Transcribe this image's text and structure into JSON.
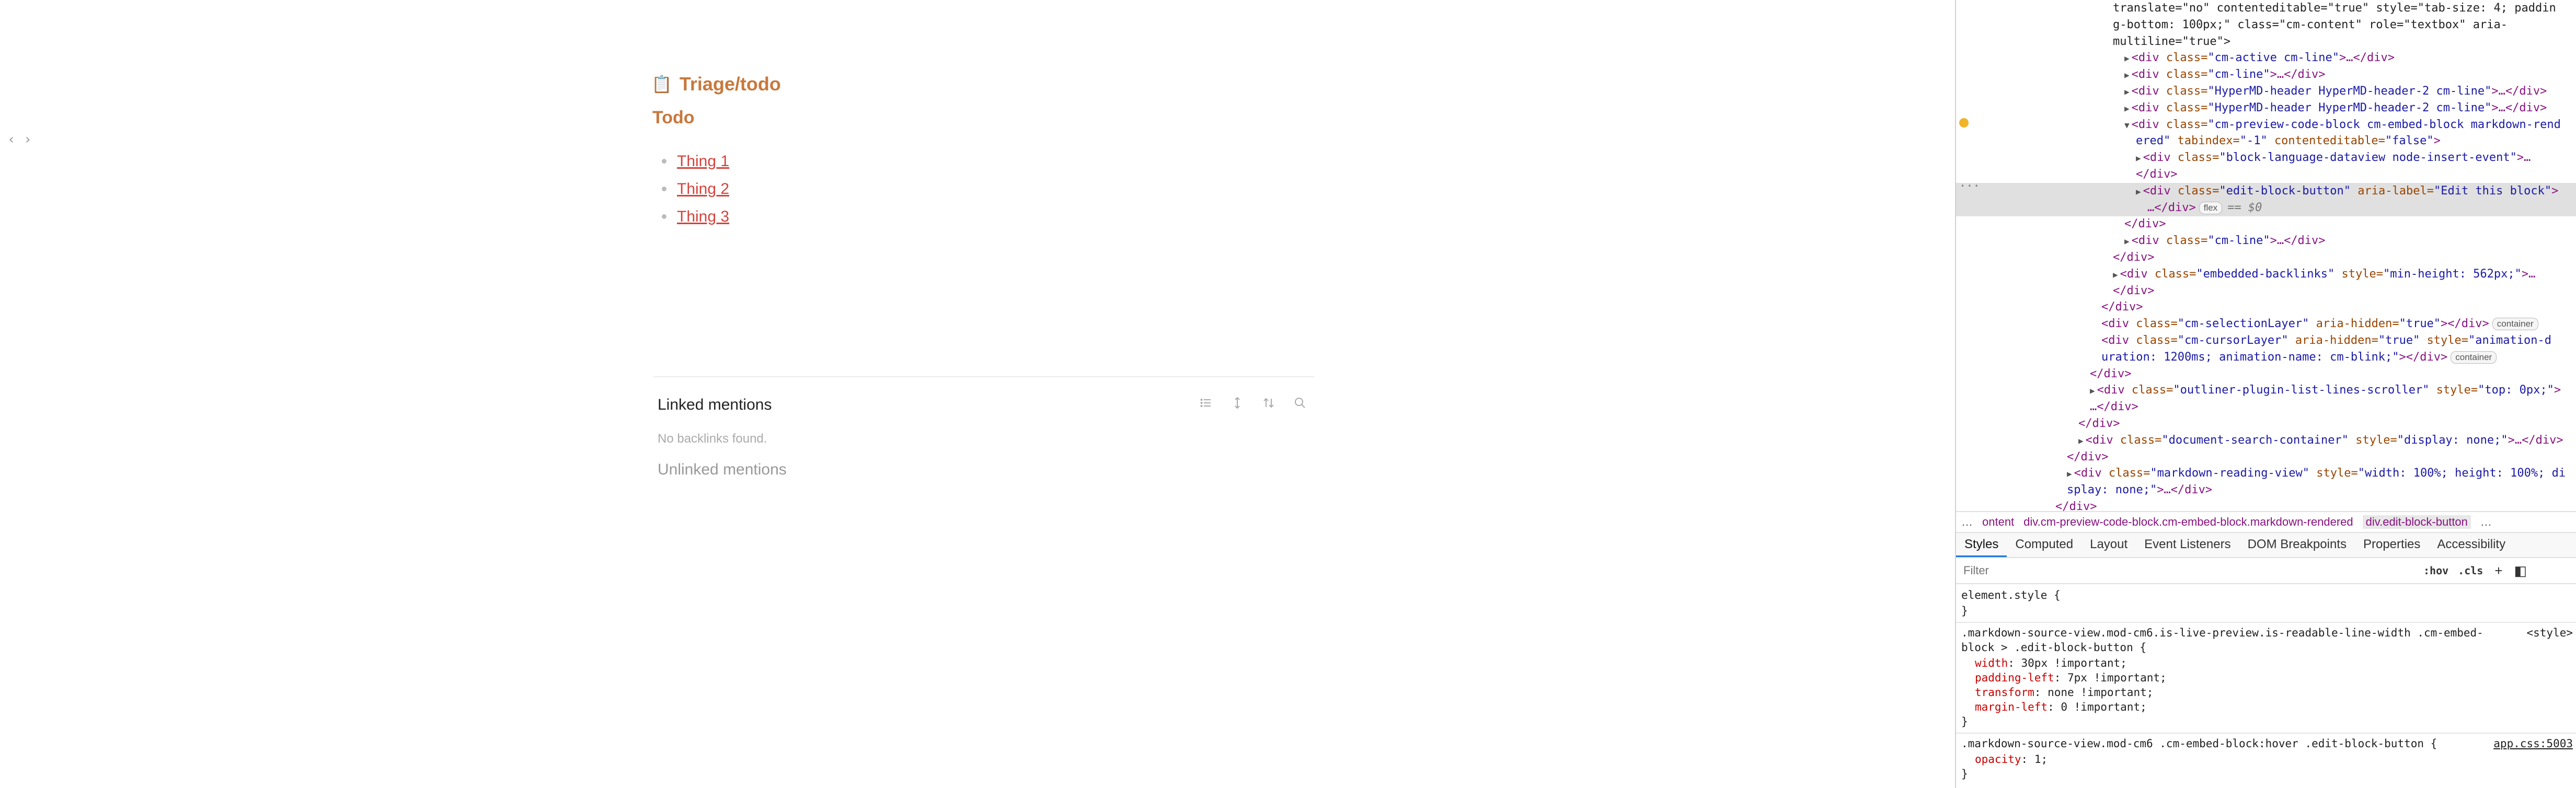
{
  "note": {
    "toggle": "‹ ›",
    "title_emoji": "📋",
    "title": "Triage/todo",
    "heading": "Todo",
    "items": [
      "Thing 1",
      "Thing 2",
      "Thing 3"
    ],
    "linked_mentions": "Linked mentions",
    "no_backlinks": "No backlinks found.",
    "unlinked_mentions": "Unlinked mentions"
  },
  "devtools": {
    "dom_lines": [
      {
        "parts": [
          [
            "tx",
            "translate=\"no\" contenteditable=\"true\" style=\"tab-size: 4; paddin"
          ]
        ]
      },
      {
        "parts": [
          [
            "tx",
            "g-bottom: 100px;\" class=\"cm-content\" role=\"textbox\" aria-"
          ]
        ]
      },
      {
        "parts": [
          [
            "tx",
            "multiline=\"true\">"
          ]
        ]
      },
      {
        "parts": [
          [
            "tri",
            "▶"
          ],
          [
            "tg",
            "<div "
          ],
          [
            "an",
            "class="
          ],
          [
            "av",
            "\"cm-active cm-line\""
          ],
          [
            "tg",
            ">…</div>"
          ]
        ]
      },
      {
        "parts": [
          [
            "tri",
            "▶"
          ],
          [
            "tg",
            "<div "
          ],
          [
            "an",
            "class="
          ],
          [
            "av",
            "\"cm-line\""
          ],
          [
            "tg",
            ">…</div>"
          ]
        ]
      },
      {
        "parts": [
          [
            "tri",
            "▶"
          ],
          [
            "tg",
            "<div "
          ],
          [
            "an",
            "class="
          ],
          [
            "av",
            "\"HyperMD-header HyperMD-header-2 cm-line\""
          ],
          [
            "tg",
            ">…</div>"
          ]
        ]
      },
      {
        "parts": [
          [
            "tri",
            "▶"
          ],
          [
            "tg",
            "<div "
          ],
          [
            "an",
            "class="
          ],
          [
            "av",
            "\"HyperMD-header HyperMD-header-2 cm-line\""
          ],
          [
            "tg",
            ">…</div>"
          ]
        ]
      },
      {
        "parts": [
          [
            "tri",
            "▼"
          ],
          [
            "tg",
            "<div "
          ],
          [
            "an",
            "class="
          ],
          [
            "av",
            "\"cm-preview-code-block cm-embed-block markdown-rend"
          ]
        ]
      },
      {
        "parts": [
          [
            "av",
            "ered\" "
          ],
          [
            "an",
            "tabindex="
          ],
          [
            "av",
            "\"-1\" "
          ],
          [
            "an",
            "contenteditable="
          ],
          [
            "av",
            "\"false\""
          ],
          [
            "tg",
            ">"
          ]
        ]
      },
      {
        "parts": [
          [
            "tri",
            "▶"
          ],
          [
            "tg",
            "<div "
          ],
          [
            "an",
            "class="
          ],
          [
            "av",
            "\"block-language-dataview node-insert-event\""
          ],
          [
            "tg",
            ">…"
          ]
        ]
      },
      {
        "parts": [
          [
            "tg",
            "</div>"
          ]
        ]
      },
      {
        "parts": [
          [
            "tri",
            "▶"
          ],
          [
            "tg",
            "<div "
          ],
          [
            "an",
            "class="
          ],
          [
            "av",
            "\"edit-block-button\" "
          ],
          [
            "an",
            "aria-label="
          ],
          [
            "av",
            "\"Edit this block\""
          ],
          [
            "tg",
            ">"
          ]
        ]
      },
      {
        "parts": [
          [
            "tg",
            "…</div>"
          ],
          [
            "pill",
            "flex"
          ],
          [
            "eq",
            "== $0"
          ]
        ]
      },
      {
        "parts": [
          [
            "tg",
            "</div>"
          ]
        ]
      },
      {
        "parts": [
          [
            "tri",
            "▶"
          ],
          [
            "tg",
            "<div "
          ],
          [
            "an",
            "class="
          ],
          [
            "av",
            "\"cm-line\""
          ],
          [
            "tg",
            ">…</div>"
          ]
        ]
      },
      {
        "parts": [
          [
            "tg",
            "</div>"
          ]
        ]
      },
      {
        "parts": [
          [
            "tri",
            "▶"
          ],
          [
            "tg",
            "<div "
          ],
          [
            "an",
            "class="
          ],
          [
            "av",
            "\"embedded-backlinks\" "
          ],
          [
            "an",
            "style="
          ],
          [
            "av",
            "\"min-height: 562px;\""
          ],
          [
            "tg",
            ">…"
          ]
        ]
      },
      {
        "parts": [
          [
            "tg",
            "</div>"
          ]
        ]
      },
      {
        "parts": [
          [
            "tg",
            "</div>"
          ]
        ]
      },
      {
        "parts": [
          [
            "tg",
            "<div "
          ],
          [
            "an",
            "class="
          ],
          [
            "av",
            "\"cm-selectionLayer\" "
          ],
          [
            "an",
            "aria-hidden="
          ],
          [
            "av",
            "\"true\""
          ],
          [
            "tg",
            "></div>"
          ],
          [
            "pill",
            "container"
          ]
        ]
      },
      {
        "parts": [
          [
            "tg",
            "<div "
          ],
          [
            "an",
            "class="
          ],
          [
            "av",
            "\"cm-cursorLayer\" "
          ],
          [
            "an",
            "aria-hidden="
          ],
          [
            "av",
            "\"true\" "
          ],
          [
            "an",
            "style="
          ],
          [
            "av",
            "\"animation-d"
          ]
        ]
      },
      {
        "parts": [
          [
            "av",
            "uration: 1200ms; animation-name: cm-blink;\""
          ],
          [
            "tg",
            "></div>"
          ],
          [
            "pill",
            "container"
          ]
        ]
      },
      {
        "parts": [
          [
            "tg",
            "</div>"
          ]
        ]
      },
      {
        "parts": [
          [
            "tri",
            "▶"
          ],
          [
            "tg",
            "<div "
          ],
          [
            "an",
            "class="
          ],
          [
            "av",
            "\"outliner-plugin-list-lines-scroller\" "
          ],
          [
            "an",
            "style="
          ],
          [
            "av",
            "\"top: 0px;\""
          ],
          [
            "tg",
            ">"
          ]
        ]
      },
      {
        "parts": [
          [
            "tg",
            "…</div>"
          ]
        ]
      },
      {
        "parts": [
          [
            "tg",
            "</div>"
          ]
        ]
      },
      {
        "parts": [
          [
            "tri",
            "▶"
          ],
          [
            "tg",
            "<div "
          ],
          [
            "an",
            "class="
          ],
          [
            "av",
            "\"document-search-container\" "
          ],
          [
            "an",
            "style="
          ],
          [
            "av",
            "\"display: none;\""
          ],
          [
            "tg",
            ">…</div>"
          ]
        ]
      },
      {
        "parts": [
          [
            "tg",
            "</div>"
          ]
        ]
      },
      {
        "parts": [
          [
            "tri",
            "▶"
          ],
          [
            "tg",
            "<div "
          ],
          [
            "an",
            "class="
          ],
          [
            "av",
            "\"markdown-reading-view\" "
          ],
          [
            "an",
            "style="
          ],
          [
            "av",
            "\"width: 100%; height: 100%; di"
          ]
        ]
      },
      {
        "parts": [
          [
            "av",
            "splay: none;\""
          ],
          [
            "tg",
            ">…</div>"
          ]
        ]
      },
      {
        "parts": [
          [
            "tg",
            "</div>"
          ]
        ]
      }
    ],
    "gutter_dots": "···",
    "breadcrumbs": {
      "ellipsis": "…",
      "items": [
        "ontent",
        "div.cm-preview-code-block.cm-embed-block.markdown-rendered",
        "div.edit-block-button"
      ],
      "trailing": "…"
    },
    "tabs": [
      "Styles",
      "Computed",
      "Layout",
      "Event Listeners",
      "DOM Breakpoints",
      "Properties",
      "Accessibility"
    ],
    "filter": {
      "placeholder": "Filter",
      "hov": ":hov",
      "cls": ".cls",
      "plus": "+",
      "toggle": "◧"
    },
    "styles": {
      "element_style": "element.style {",
      "close": "}",
      "rule1_selector_a": ".markdown-source-view.mod-cm6.is-live-preview.is-readable-line-width .cm-embed-",
      "rule1_selector_b": "block > .edit-block-button {",
      "rule1_source": "<style>",
      "rule1_props": [
        {
          "name": "width",
          "value": "30px !important;"
        },
        {
          "name": "padding-left",
          "value": "7px !important;"
        },
        {
          "name": "transform",
          "value": "none !important;"
        },
        {
          "name": "margin-left",
          "value": "0 !important;"
        }
      ],
      "rule2_selector": ".markdown-source-view.mod-cm6 .cm-embed-block:hover .edit-block-button {",
      "rule2_source": "app.css:5003",
      "rule2_props": [
        {
          "name": "opacity",
          "value": "1;"
        }
      ]
    },
    "colors": {
      "accent": "#c8783c",
      "link": "#d4433c",
      "tab_active": "#1a73e8"
    }
  }
}
